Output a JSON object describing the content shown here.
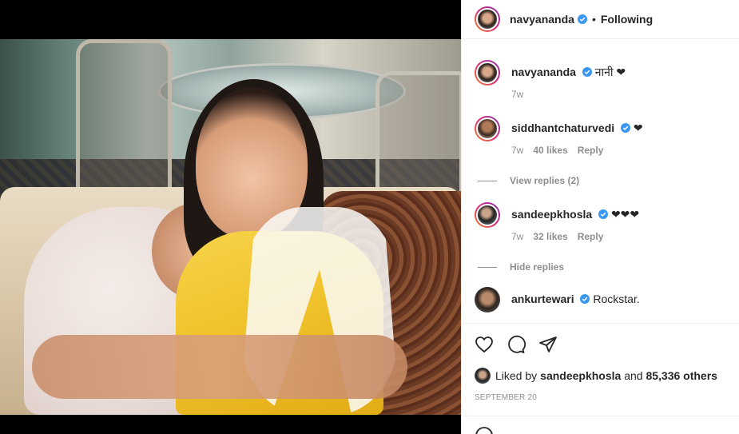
{
  "header": {
    "username": "navyananda",
    "dot": "•",
    "follow_status": "Following"
  },
  "comments": [
    {
      "username": "navyananda",
      "text": "नानी ❤",
      "time": "7w",
      "likes": "",
      "reply": ""
    },
    {
      "username": "siddhantchaturvedi",
      "text": "❤",
      "time": "7w",
      "likes": "40 likes",
      "reply": "Reply",
      "replies_toggle": "View replies (2)"
    },
    {
      "username": "sandeepkhosla",
      "text": "❤❤❤",
      "time": "7w",
      "likes": "32 likes",
      "reply": "Reply",
      "replies_toggle": "Hide replies"
    },
    {
      "username": "ankurtewari",
      "text": "Rockstar."
    }
  ],
  "likes": {
    "prefix": "Liked by ",
    "liker": "sandeepkhosla",
    "suffix": " and ",
    "count": "85,336 others"
  },
  "date": "SEPTEMBER 20",
  "icons": [
    "heart-icon",
    "comment-icon",
    "share-icon",
    "emoji-icon",
    "verified-badge-icon"
  ],
  "colors": {
    "verified": "#3897f0",
    "text": "#262626",
    "muted": "#8e8e8e"
  }
}
